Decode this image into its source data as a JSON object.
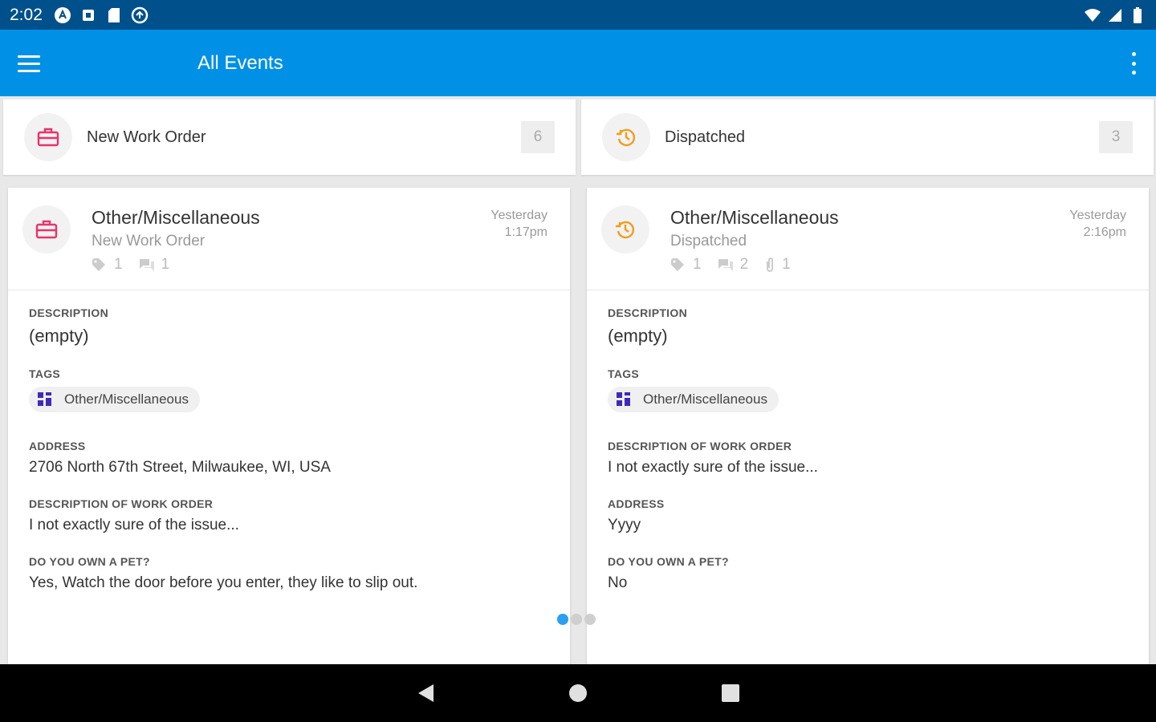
{
  "status_bar": {
    "time": "2:02"
  },
  "app_bar": {
    "title": "All Events"
  },
  "columns": [
    {
      "header": {
        "label": "New Work Order",
        "count": "6"
      },
      "card": {
        "title": "Other/Miscellaneous",
        "subtitle": "New Work Order",
        "time_line1": "Yesterday",
        "time_line2": "1:17pm",
        "tag_count": "1",
        "comment_count": "1",
        "fields": [
          {
            "label": "DESCRIPTION",
            "value": "(empty)"
          },
          {
            "label": "TAGS",
            "value": "Other/Miscellaneous"
          },
          {
            "label": "ADDRESS",
            "value": "2706 North 67th Street, Milwaukee, WI, USA"
          },
          {
            "label": "DESCRIPTION OF WORK ORDER",
            "value": "I not exactly sure of the issue..."
          },
          {
            "label": "DO YOU OWN A PET?",
            "value": "Yes, Watch the door before you enter, they like to slip out."
          }
        ]
      }
    },
    {
      "header": {
        "label": "Dispatched",
        "count": "3"
      },
      "card": {
        "title": "Other/Miscellaneous",
        "subtitle": "Dispatched",
        "time_line1": "Yesterday",
        "time_line2": "2:16pm",
        "tag_count": "1",
        "comment_count": "2",
        "attachment_count": "1",
        "fields": [
          {
            "label": "DESCRIPTION",
            "value": "(empty)"
          },
          {
            "label": "TAGS",
            "value": "Other/Miscellaneous"
          },
          {
            "label": "DESCRIPTION OF WORK ORDER",
            "value": "I not exactly sure of the issue..."
          },
          {
            "label": "ADDRESS",
            "value": "Yyyy"
          },
          {
            "label": "DO YOU OWN A PET?",
            "value": "No"
          }
        ]
      }
    }
  ],
  "pager": {
    "pages": 3,
    "active": 1
  },
  "colors": {
    "status_bar": "#00508c",
    "app_bar": "#0090e6",
    "new_work_order_icon": "#e8336b",
    "dispatched_icon": "#f39c1a",
    "tag_icon": "#3d2bb8"
  },
  "icons": {
    "new_work_order": "briefcase-icon",
    "dispatched": "history-clock-icon",
    "tag": "tag-icon",
    "comment": "comment-icon",
    "attachment": "attachment-icon"
  }
}
